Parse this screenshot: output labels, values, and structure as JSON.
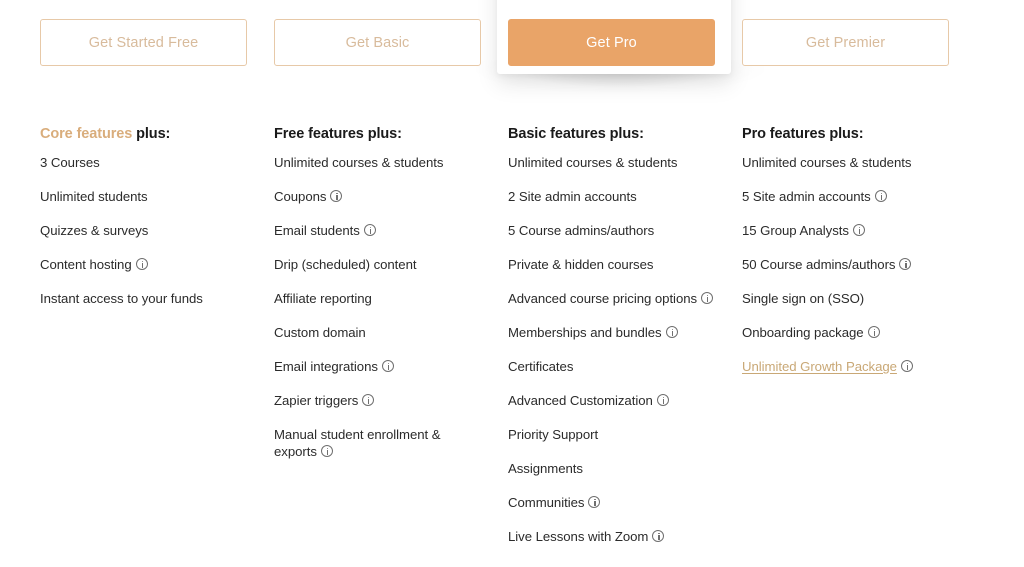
{
  "plans": [
    {
      "cta": {
        "label": "Get Started Free",
        "style": "outline",
        "name": "get-started-free-button"
      },
      "heading": {
        "accent": "Core features",
        "rest": "plus:"
      },
      "highlighted": false,
      "features": [
        {
          "label": "3 Courses",
          "info": false
        },
        {
          "label": "Unlimited students",
          "info": false
        },
        {
          "label": "Quizzes & surveys",
          "info": false
        },
        {
          "label": "Content hosting",
          "info": true
        },
        {
          "label": "Instant access to your funds",
          "info": false
        }
      ]
    },
    {
      "cta": {
        "label": "Get Basic",
        "style": "outline",
        "name": "get-basic-button"
      },
      "heading": {
        "accent": "",
        "rest": "Free features plus:"
      },
      "highlighted": false,
      "features": [
        {
          "label": "Unlimited courses & students",
          "info": false
        },
        {
          "label": "Coupons",
          "info": true
        },
        {
          "label": "Email students",
          "info": true
        },
        {
          "label": "Drip (scheduled) content",
          "info": false
        },
        {
          "label": "Affiliate reporting",
          "info": false
        },
        {
          "label": "Custom domain",
          "info": false
        },
        {
          "label": "Email integrations",
          "info": true
        },
        {
          "label": "Zapier triggers",
          "info": true
        },
        {
          "label": "Manual student enrollment & exports",
          "info": true
        }
      ]
    },
    {
      "cta": {
        "label": "Get Pro",
        "style": "filled",
        "name": "get-pro-button"
      },
      "heading": {
        "accent": "",
        "rest": "Basic features plus:"
      },
      "highlighted": true,
      "features": [
        {
          "label": "Unlimited courses & students",
          "info": false
        },
        {
          "label": "2 Site admin accounts",
          "info": false
        },
        {
          "label": "5 Course admins/authors",
          "info": false
        },
        {
          "label": "Private & hidden courses",
          "info": false
        },
        {
          "label": "Advanced course pricing options",
          "info": true
        },
        {
          "label": "Memberships and bundles",
          "info": true
        },
        {
          "label": "Certificates",
          "info": false
        },
        {
          "label": "Advanced Customization",
          "info": true
        },
        {
          "label": "Priority Support",
          "info": false
        },
        {
          "label": "Assignments",
          "info": false
        },
        {
          "label": "Communities",
          "info": true
        },
        {
          "label": "Live Lessons with Zoom",
          "info": true
        }
      ]
    },
    {
      "cta": {
        "label": "Get Premier",
        "style": "outline",
        "name": "get-premier-button"
      },
      "heading": {
        "accent": "",
        "rest": "Pro features plus:"
      },
      "highlighted": false,
      "features": [
        {
          "label": "Unlimited courses & students",
          "info": false
        },
        {
          "label": "5 Site admin accounts",
          "info": true
        },
        {
          "label": "15 Group Analysts",
          "info": true
        },
        {
          "label": "50 Course admins/authors",
          "info": true
        },
        {
          "label": "Single sign on (SSO)",
          "info": false
        },
        {
          "label": "Onboarding package",
          "info": true
        },
        {
          "label": "Unlimited Growth Package",
          "info": true,
          "link": true
        }
      ]
    }
  ],
  "icons": {
    "info": "info-icon"
  },
  "colors": {
    "accent_orange": "#e9a468",
    "accent_tan": "#d9ad7c",
    "outline_border": "#e7c9a8",
    "outline_text": "#d8bb9c",
    "text_dark": "#2b2b2b",
    "background": "#ffffff"
  }
}
